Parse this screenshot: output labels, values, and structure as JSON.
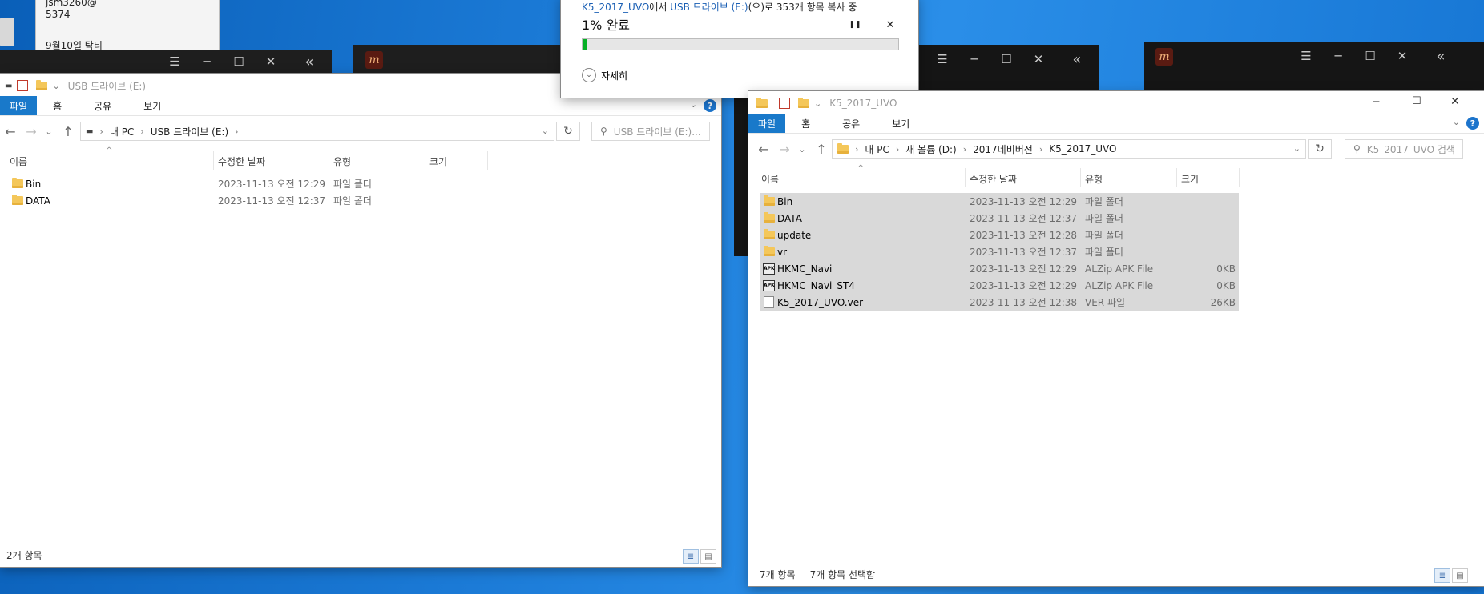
{
  "sticky_note": {
    "line1": "jsm3260@",
    "line2": "5374",
    "line3": "9월10일 탁티"
  },
  "glyphs": {
    "menu": "☰",
    "minimize": "─",
    "maximize": "☐",
    "close": "✕",
    "collapse": "«",
    "pause": "❚❚",
    "back": "←",
    "forward": "→",
    "up": "↑",
    "dropdown": "⌄",
    "refresh": "↻",
    "search": "⚲",
    "separator": "›",
    "help": "?",
    "sort": "^",
    "expand": "⌄",
    "drive": "▬",
    "app_logo": "m"
  },
  "copy_dialog": {
    "source_link": "K5_2017_UVO",
    "text_from": "에서 ",
    "dest_link": "USB 드라이브 (E:)",
    "text_rest": "(으)로 353개 항목 복사 중",
    "progress_label": "1% 완료",
    "progress_value": 0.01,
    "details_label": "자세히"
  },
  "left_explorer": {
    "title": "USB 드라이브 (E:)",
    "tabs": [
      "파일",
      "홈",
      "공유",
      "보기"
    ],
    "breadcrumb": [
      "내 PC",
      "USB 드라이브 (E:)"
    ],
    "search_placeholder": "USB 드라이브 (E:)...",
    "columns": [
      "이름",
      "수정한 날짜",
      "유형",
      "크기"
    ],
    "rows": [
      {
        "name": "Bin",
        "date": "2023-11-13 오전 12:29",
        "type": "파일 폴더",
        "size": ""
      },
      {
        "name": "DATA",
        "date": "2023-11-13 오전 12:37",
        "type": "파일 폴더",
        "size": ""
      }
    ],
    "status": "2개 항목"
  },
  "right_explorer": {
    "title": "K5_2017_UVO",
    "tabs": [
      "파일",
      "홈",
      "공유",
      "보기"
    ],
    "breadcrumb": [
      "내 PC",
      "새 볼륨 (D:)",
      "2017네비버전",
      "K5_2017_UVO"
    ],
    "search_placeholder": "K5_2017_UVO 검색",
    "columns": [
      "이름",
      "수정한 날짜",
      "유형",
      "크기"
    ],
    "rows": [
      {
        "name": "Bin",
        "date": "2023-11-13 오전 12:29",
        "type": "파일 폴더",
        "size": "",
        "icon": "folder"
      },
      {
        "name": "DATA",
        "date": "2023-11-13 오전 12:37",
        "type": "파일 폴더",
        "size": "",
        "icon": "folder"
      },
      {
        "name": "update",
        "date": "2023-11-13 오전 12:28",
        "type": "파일 폴더",
        "size": "",
        "icon": "folder"
      },
      {
        "name": "vr",
        "date": "2023-11-13 오전 12:37",
        "type": "파일 폴더",
        "size": "",
        "icon": "folder"
      },
      {
        "name": "HKMC_Navi",
        "date": "2023-11-13 오전 12:29",
        "type": "ALZip APK File",
        "size": "0KB",
        "icon": "apk"
      },
      {
        "name": "HKMC_Navi_ST4",
        "date": "2023-11-13 오전 12:29",
        "type": "ALZip APK File",
        "size": "0KB",
        "icon": "apk"
      },
      {
        "name": "K5_2017_UVO.ver",
        "date": "2023-11-13 오전 12:38",
        "type": "VER 파일",
        "size": "26KB",
        "icon": "file"
      }
    ],
    "status_count": "7개 항목",
    "status_selected": "7개 항목 선택함"
  }
}
